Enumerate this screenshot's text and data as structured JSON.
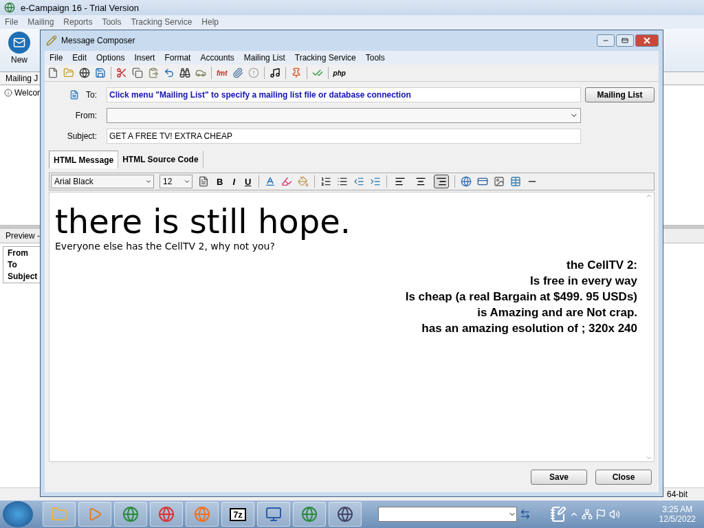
{
  "app": {
    "title": "e-Campaign 16 - Trial Version",
    "menu": [
      "File",
      "Mailing",
      "Reports",
      "Tools",
      "Tracking Service",
      "Help"
    ],
    "new_button": "New",
    "tab": "Mailing J",
    "list_item": "Welcon",
    "preview_title": "Preview -",
    "preview_fields": [
      "From",
      "To",
      "Subject"
    ],
    "status": "64-bit"
  },
  "composer": {
    "title": "Message Composer",
    "menu": [
      "File",
      "Edit",
      "Options",
      "Insert",
      "Format",
      "Accounts",
      "Mailing List",
      "Tracking Service",
      "Tools"
    ],
    "toolbar": {
      "fmt": "fmt",
      "php": "php"
    },
    "to_label": "To:",
    "to_value": "Click menu \"Mailing List\" to specify a mailing list file or database connection",
    "mailing_list_button": "Mailing List",
    "from_label": "From:",
    "subject_label": "Subject:",
    "subject_value": "GET A FREE TV! EXTRA CHEAP",
    "tabs": [
      {
        "label": "HTML Message",
        "selected": true
      },
      {
        "label": "HTML Source Code",
        "selected": false
      }
    ],
    "font": "Arial Black",
    "size": "12",
    "bold": "B",
    "italic": "I",
    "underline": "U",
    "align": [
      {
        "kind": "left",
        "selected": false
      },
      {
        "kind": "center",
        "selected": false
      },
      {
        "kind": "right",
        "selected": true
      }
    ],
    "heading": "there is still hope.",
    "intro": "Everyone else has the CellTV 2, why not you?",
    "lines": [
      "the CellTV 2:",
      "Is free in every way",
      "Is cheap (a real Bargain at $499. 95 USDs)",
      "is Amazing and are Not crap.",
      "has an amazing esolution of ; 320x 240"
    ],
    "buttons": [
      "Save",
      "Close"
    ]
  },
  "taskbar": {
    "seven_zip": "7z",
    "clock_time": "3:25 AM",
    "clock_date": "12/5/2022"
  }
}
